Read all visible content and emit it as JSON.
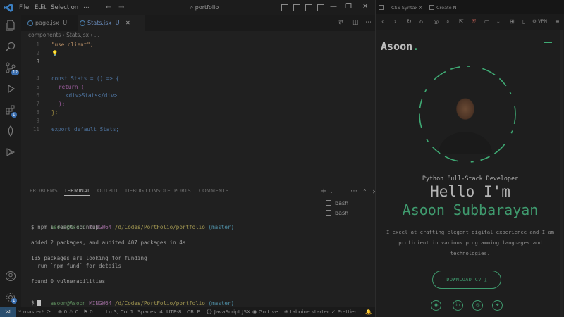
{
  "vscode": {
    "menu": [
      "File",
      "Edit",
      "Selection",
      "⋯"
    ],
    "search_text": "portfolio",
    "activity_badges": {
      "source_control": "12",
      "extensions": "1",
      "accounts_bottom": "1"
    },
    "tabs": [
      {
        "label": "page.jsx",
        "status": "U",
        "active": false
      },
      {
        "label": "Stats.jsx",
        "status": "U",
        "active": true
      }
    ],
    "breadcrumb": [
      "components",
      "Stats.jsx",
      "..."
    ],
    "code": [
      {
        "n": "1",
        "text": "\"use client\";"
      },
      {
        "n": "2",
        "text": ""
      },
      {
        "n": "3",
        "text": ""
      },
      {
        "n": "4",
        "text": "const Stats = () => {"
      },
      {
        "n": "5",
        "text": "return ("
      },
      {
        "n": "6",
        "text": "<div>Stats</div>"
      },
      {
        "n": "7",
        "text": ");"
      },
      {
        "n": "8",
        "text": "};"
      },
      {
        "n": "9",
        "text": ""
      },
      {
        "n": "11",
        "text": "export default Stats;"
      }
    ],
    "panel_tabs": [
      "PROBLEMS",
      "TERMINAL",
      "OUTPUT",
      "DEBUG CONSOLE",
      "PORTS",
      "COMMENTS"
    ],
    "active_panel": "TERMINAL",
    "terminal": {
      "prompt_user": "asoon@Asoon",
      "prompt_env": "MINGW64",
      "prompt_path": "/d/Codes/PortFolio/portfolio",
      "prompt_branch": "(master)",
      "command": "$ npm i react-countup",
      "out1": "added 2 packages, and audited 407 packages in 4s",
      "out2": "135 packages are looking for funding",
      "out3": "  run `npm fund` for details",
      "out4": "found 0 vulnerabilities",
      "prompt2": "$ "
    },
    "terminals": [
      "bash",
      "bash"
    ],
    "status": {
      "branch": "master*",
      "errors": "⊗ 0 ⚠ 0",
      "warnings2": "⚑ 0",
      "position": "Ln 3, Col 1",
      "spaces": "Spaces: 4",
      "encoding": "UTF-8",
      "eol": "CRLF",
      "language": "JavaScript JSX",
      "golive": "Go Live",
      "tabnine": "tabnine starter",
      "prettier": "Prettier"
    }
  },
  "browser": {
    "tabs": [
      {
        "label": "CSS Syntax X"
      },
      {
        "label": "Create N"
      }
    ],
    "vpn": "VPN"
  },
  "site": {
    "logo": "Asoon",
    "logo_dot": ".",
    "role": "Python Full-Stack Developer",
    "greeting": "Hello I'm",
    "name": "Asoon Subbarayan",
    "about": "I excel at crafting elegent digital experience and I am proficient in various programming languages and technologies.",
    "cv_button": "DOWNLOAD CV ⤓",
    "socials": [
      "github-icon",
      "linkedin-icon",
      "instagram-icon",
      "twitter-icon"
    ],
    "accent_color": "#3f9a6e"
  }
}
